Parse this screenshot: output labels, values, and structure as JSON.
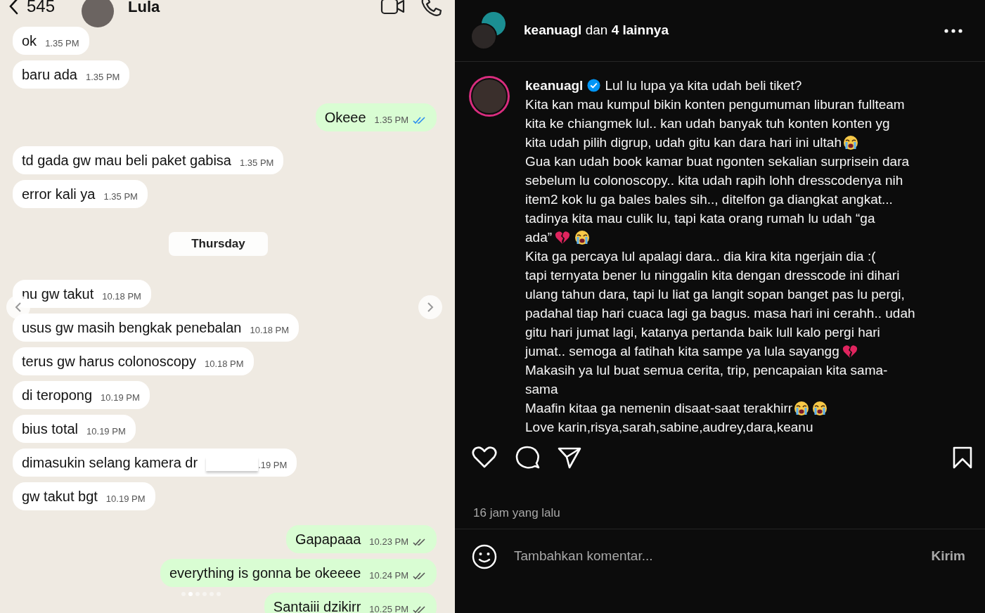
{
  "chat": {
    "header": {
      "back": "545",
      "name": "Lula"
    },
    "messages": [
      {
        "kind": "in",
        "text": "ok",
        "time": "1.35 PM"
      },
      {
        "kind": "in",
        "text": "baru ada",
        "time": "1.35 PM"
      },
      {
        "kind": "out",
        "text": "Okeee",
        "time": "1.35 PM",
        "read": true
      },
      {
        "kind": "in",
        "text": "td gada gw mau beli paket gabisa",
        "time": "1.35 PM"
      },
      {
        "kind": "in",
        "text": "error kali ya",
        "time": "1.35 PM"
      },
      {
        "kind": "date",
        "text": "Thursday"
      },
      {
        "kind": "in",
        "text": "nu gw takut",
        "time": "10.18 PM"
      },
      {
        "kind": "in",
        "text": "usus gw masih bengkak penebalan",
        "time": "10.18 PM"
      },
      {
        "kind": "in",
        "text": "terus gw harus colonoscopy",
        "time": "10.18 PM"
      },
      {
        "kind": "in",
        "text": "di teropong",
        "time": "10.19 PM"
      },
      {
        "kind": "in",
        "text": "bius total",
        "time": "10.19 PM"
      },
      {
        "kind": "in",
        "text": "dimasukin selang kamera dr",
        "time": ".19 PM",
        "redacted": true
      },
      {
        "kind": "in",
        "text": "gw takut bgt",
        "time": "10.19 PM"
      },
      {
        "kind": "out",
        "text": "Gapapaaa",
        "time": "10.23 PM",
        "read": false
      },
      {
        "kind": "out",
        "text": "everything is gonna be okeeee",
        "time": "10.24 PM",
        "read": false
      },
      {
        "kind": "out",
        "text": "Santaiii dzikirr",
        "time": "10.25 PM",
        "read": false
      }
    ]
  },
  "post": {
    "authors": "**keanuagl** dan **4 lainnya**",
    "caption": {
      "username": "keanuagl",
      "verified": true,
      "lines": [
        [
          {
            "kind": "text",
            "text": "Lul lu lupa ya kita udah beli tiket?"
          }
        ],
        [
          {
            "kind": "text",
            "text": "Kita kan mau kumpul bikin konten pengumuman liburan fullteam"
          }
        ],
        [
          {
            "kind": "text",
            "text": "kita ke chiangmek lul.. kan udah banyak tuh konten konten yg"
          }
        ],
        [
          {
            "kind": "text",
            "text": "kita udah pilih digrup, udah gitu kan dara hari ini ultah"
          },
          {
            "kind": "sob"
          }
        ],
        [
          {
            "kind": "text",
            "text": "Gua kan udah book kamar buat ngonten sekalian surprisein dara"
          }
        ],
        [
          {
            "kind": "text",
            "text": "sebelum lu colonoscopy.. kita udah rapih lohh dresscodenya nih"
          }
        ],
        [
          {
            "kind": "text",
            "text": "item2 kok lu ga bales bales sih.., ditelfon ga diangkat angkat..."
          }
        ],
        [
          {
            "kind": "text",
            "text": "tadinya kita mau culik lu, tapi kata orang rumah lu udah “ga"
          }
        ],
        [
          {
            "kind": "text",
            "text": "ada”"
          },
          {
            "kind": "heartbreak"
          },
          {
            "kind": "sob"
          }
        ],
        [
          {
            "kind": "text",
            "text": "Kita ga percaya lul apalagi dara.. dia kira kita ngerjain dia :("
          }
        ],
        [
          {
            "kind": "text",
            "text": "tapi ternyata bener lu ninggalin kita dengan dresscode ini dihari"
          }
        ],
        [
          {
            "kind": "text",
            "text": "ulang tahun dara, tapi lu liat ga langit sopan banget pas lu pergi,"
          }
        ],
        [
          {
            "kind": "text",
            "text": "padahal tiap hari cuaca lagi ga bagus. masa hari ini cerahh.. udah"
          }
        ],
        [
          {
            "kind": "text",
            "text": "gitu hari jumat lagi, katanya pertanda baik lull kalo pergi hari"
          }
        ],
        [
          {
            "kind": "text",
            "text": "jumat.. semoga al fatihah kita sampe ya lula sayangg"
          },
          {
            "kind": "heartbreak"
          }
        ],
        [
          {
            "kind": "text",
            "text": "Makasih ya lul buat semua cerita, trip, pencapaian kita sama-"
          }
        ],
        [
          {
            "kind": "text",
            "text": "sama"
          }
        ],
        [
          {
            "kind": "text",
            "text": "Maafin kitaa ga nemenin disaat-saat terakhirr"
          },
          {
            "kind": "sob"
          },
          {
            "kind": "sob"
          }
        ],
        [
          {
            "kind": "text",
            "text": "Love karin,risya,sarah,sabine,audrey,dara,keanu"
          }
        ]
      ]
    },
    "liked": false,
    "saved": false,
    "time": "16 jam yang lalu",
    "comment": {
      "placeholder": "Tambahkan komentar...",
      "submit": "Kirim"
    }
  }
}
